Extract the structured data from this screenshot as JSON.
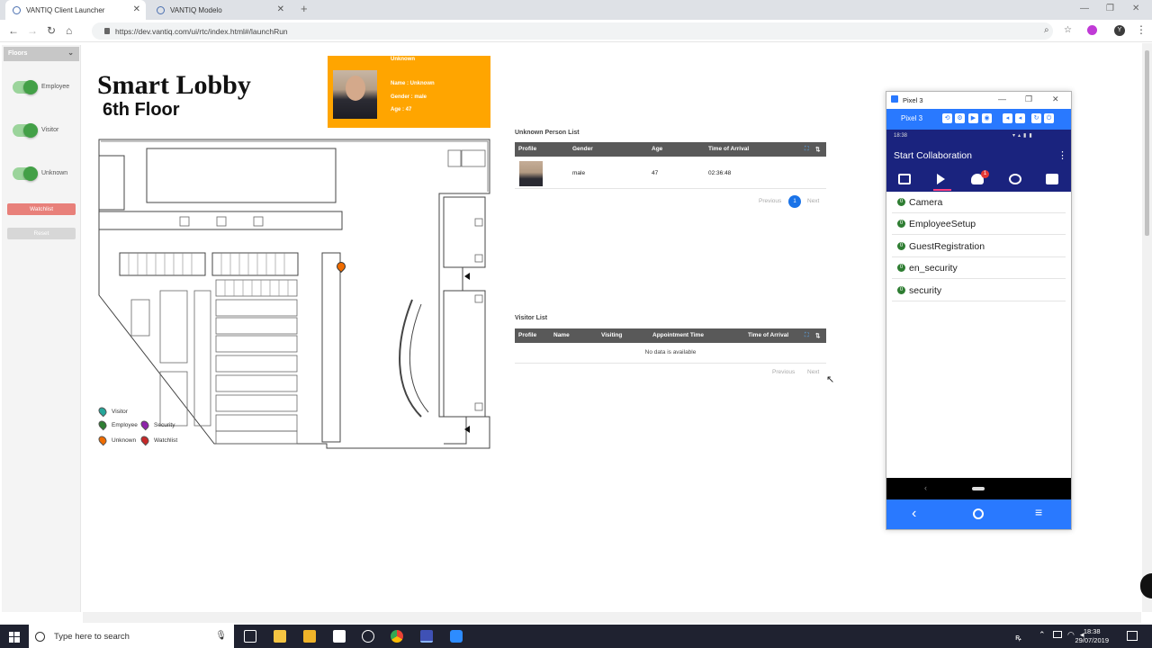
{
  "browser": {
    "tabs": [
      {
        "label": "VANTIQ Client Launcher"
      },
      {
        "label": "VANTIQ Modelo"
      }
    ],
    "url": "https://dev.vantiq.com/ui/rtc/index.html#/launchRun"
  },
  "left_panel": {
    "dropdown": "Floors",
    "toggles": [
      {
        "label": "Employee",
        "on": true
      },
      {
        "label": "Visitor",
        "on": true
      },
      {
        "label": "Unknown",
        "on": true
      }
    ],
    "buttons": {
      "watchlist": "Watchlist",
      "reset": "Reset"
    },
    "colors": {
      "watchlist": "#e8807a",
      "reset": "#d7d7d7"
    }
  },
  "header": {
    "title": "Smart Lobby",
    "subtitle": "6th Floor"
  },
  "detected_card": {
    "heading": "Unknown",
    "name": "Name : Unknown",
    "gender": "Gender : male",
    "age": "Age : 47",
    "color": "#ffa500"
  },
  "legend": [
    {
      "label": "Visitor",
      "color": "#26a69a"
    },
    {
      "label": "Employee",
      "color": "#2e7d32"
    },
    {
      "label": "Security",
      "color": "#8e24aa"
    },
    {
      "label": "Unknown",
      "color": "#ef6c00"
    },
    {
      "label": "Watchlist",
      "color": "#c62828"
    }
  ],
  "unknown_list": {
    "title": "Unknown Person List",
    "columns": [
      "Profile",
      "Gender",
      "Age",
      "Time of Arrival"
    ],
    "rows": [
      {
        "gender": "male",
        "age": "47",
        "time": "02:36:48"
      }
    ],
    "pager": {
      "previous": "Previous",
      "page": "1",
      "next": "Next"
    }
  },
  "visitor_list": {
    "title": "Visitor List",
    "columns": [
      "Profile",
      "Name",
      "Visiting",
      "Appointment Time",
      "Time of Arrival"
    ],
    "empty": "No data is available",
    "pager": {
      "previous": "Previous",
      "next": "Next"
    }
  },
  "phone": {
    "window_title": "Pixel 3",
    "toolbar_label": "Pixel 3",
    "status_time": "18:38",
    "app_title": "Start Collaboration",
    "notification_count": "1",
    "items": [
      {
        "label": "Camera",
        "badge": "0"
      },
      {
        "label": "EmployeeSetup",
        "badge": "0"
      },
      {
        "label": "GuestRegistration",
        "badge": "0"
      },
      {
        "label": "en_security",
        "badge": "0"
      },
      {
        "label": "security",
        "badge": "0"
      }
    ]
  },
  "taskbar": {
    "search_placeholder": "Type here to search",
    "time": "18:38",
    "date": "29/07/2019"
  }
}
